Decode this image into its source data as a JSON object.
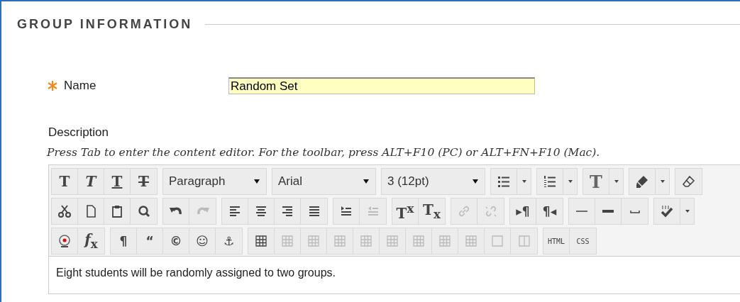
{
  "section": {
    "title": "GROUP INFORMATION"
  },
  "name_field": {
    "label": "Name",
    "value": "Random Set",
    "required": true
  },
  "description": {
    "label": "Description",
    "hint": "Press Tab to enter the content editor. For the toolbar, press ALT+F10 (PC) or ALT+FN+F10 (Mac)."
  },
  "editor": {
    "toolbar": [
      [
        {
          "items": [
            {
              "kind": "bold",
              "label": "T",
              "disabled": false
            },
            {
              "kind": "italic",
              "label": "T",
              "disabled": false
            },
            {
              "kind": "underline",
              "label": "T",
              "disabled": false
            },
            {
              "kind": "strike",
              "label": "T",
              "disabled": false
            }
          ]
        },
        {
          "items": [
            {
              "kind": "select",
              "value": "Paragraph",
              "disabled": false
            }
          ]
        },
        {
          "items": [
            {
              "kind": "select",
              "value": "Arial",
              "disabled": false
            }
          ]
        },
        {
          "items": [
            {
              "kind": "select",
              "value": "3 (12pt)",
              "disabled": false
            }
          ]
        },
        {
          "items": [
            {
              "kind": "bullet-list",
              "disabled": false
            },
            {
              "kind": "caret",
              "disabled": false
            }
          ]
        },
        {
          "items": [
            {
              "kind": "number-list",
              "disabled": false
            },
            {
              "kind": "caret",
              "disabled": false
            }
          ]
        },
        {
          "items": [
            {
              "kind": "textcolor",
              "label": "T",
              "disabled": false
            },
            {
              "kind": "caret",
              "disabled": false
            }
          ]
        },
        {
          "items": [
            {
              "kind": "highlighter",
              "disabled": false
            },
            {
              "kind": "caret",
              "disabled": false
            }
          ]
        },
        {
          "items": [
            {
              "kind": "eraser",
              "disabled": false
            }
          ]
        }
      ],
      [
        {
          "items": [
            {
              "kind": "scissors",
              "disabled": false
            },
            {
              "kind": "page",
              "disabled": false
            },
            {
              "kind": "clipboard",
              "disabled": false
            },
            {
              "kind": "search",
              "disabled": false
            }
          ]
        },
        {
          "items": [
            {
              "kind": "undo",
              "disabled": false
            },
            {
              "kind": "redo",
              "disabled": true
            }
          ]
        },
        {
          "items": [
            {
              "kind": "align-left",
              "disabled": false
            },
            {
              "kind": "align-center",
              "disabled": false
            },
            {
              "kind": "align-right",
              "disabled": false
            },
            {
              "kind": "align-justify",
              "disabled": false
            }
          ]
        },
        {
          "items": [
            {
              "kind": "indent",
              "disabled": false
            },
            {
              "kind": "outdent",
              "disabled": true
            }
          ]
        },
        {
          "items": [
            {
              "kind": "script",
              "label": "T$^{x}$",
              "disabled": false
            },
            {
              "kind": "script",
              "label": "T$_{x}$",
              "disabled": false
            }
          ]
        },
        {
          "items": [
            {
              "kind": "link",
              "disabled": true
            },
            {
              "kind": "unlink",
              "disabled": true
            }
          ]
        },
        {
          "items": [
            {
              "kind": "glyph",
              "label": "▸¶",
              "disabled": false
            },
            {
              "kind": "glyph",
              "label": "¶◂",
              "disabled": false
            }
          ]
        },
        {
          "items": [
            {
              "kind": "rule-thin",
              "disabled": false
            },
            {
              "kind": "rule-thick",
              "disabled": false
            },
            {
              "kind": "space",
              "disabled": false
            }
          ]
        },
        {
          "items": [
            {
              "kind": "spellcheck",
              "disabled": false
            },
            {
              "kind": "caret",
              "disabled": false
            }
          ]
        }
      ],
      [
        {
          "items": [
            {
              "kind": "webcam",
              "disabled": false
            },
            {
              "kind": "formula",
              "label": "*f*$_{x}$",
              "disabled": false
            }
          ]
        },
        {
          "items": [
            {
              "kind": "glyph",
              "label": "¶",
              "disabled": false
            },
            {
              "kind": "glyph",
              "label": "“",
              "disabled": false
            },
            {
              "kind": "glyph",
              "label": "©",
              "disabled": false
            },
            {
              "kind": "glyph",
              "label": "☺",
              "disabled": false
            },
            {
              "kind": "glyph",
              "label": "⚓",
              "disabled": false
            }
          ]
        },
        {
          "items": [
            {
              "kind": "table",
              "disabled": false
            },
            {
              "kind": "table",
              "disabled": true
            },
            {
              "kind": "table",
              "disabled": true
            },
            {
              "kind": "table",
              "disabled": true
            },
            {
              "kind": "table",
              "disabled": true
            },
            {
              "kind": "table",
              "disabled": true
            },
            {
              "kind": "table",
              "disabled": true
            },
            {
              "kind": "table",
              "disabled": true
            },
            {
              "kind": "table",
              "disabled": true
            },
            {
              "kind": "box",
              "disabled": true
            },
            {
              "kind": "split-box",
              "disabled": true
            }
          ]
        },
        {
          "items": [
            {
              "kind": "code",
              "label": "HTML",
              "disabled": false
            },
            {
              "kind": "code",
              "label": "CSS",
              "disabled": false
            }
          ]
        }
      ]
    ],
    "content": "Eight students will be randomly assigned to two groups."
  }
}
